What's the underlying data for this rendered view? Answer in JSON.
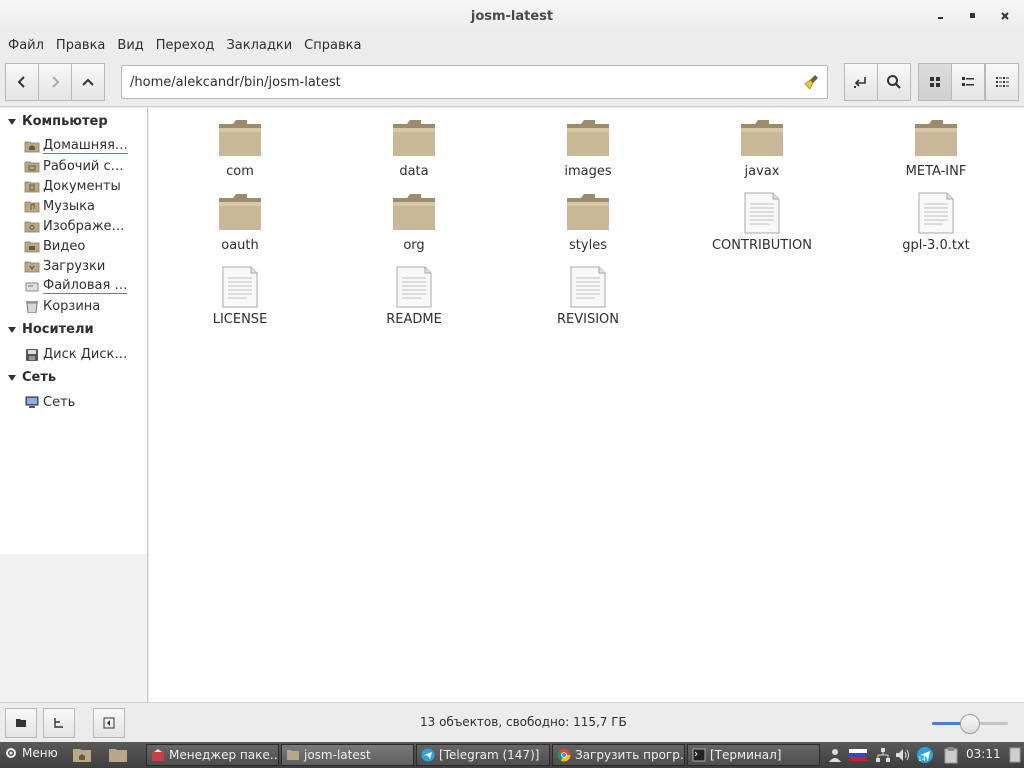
{
  "window": {
    "title": "josm-latest"
  },
  "menu": [
    "Файл",
    "Правка",
    "Вид",
    "Переход",
    "Закладки",
    "Справка"
  ],
  "toolbar": {
    "path": "/home/alekcandr/bin/josm-latest"
  },
  "sidebar": {
    "sections": [
      {
        "title": "Компьютер",
        "items": [
          "Домашняя…",
          "Рабочий с…",
          "Документы",
          "Музыка",
          "Изображе…",
          "Видео",
          "Загрузки",
          "Файловая …",
          "Корзина"
        ]
      },
      {
        "title": "Носители",
        "items": [
          "Диск Диск…"
        ]
      },
      {
        "title": "Сеть",
        "items": [
          "Сеть"
        ]
      }
    ]
  },
  "files": [
    {
      "name": "com",
      "kind": "folder"
    },
    {
      "name": "data",
      "kind": "folder"
    },
    {
      "name": "images",
      "kind": "folder"
    },
    {
      "name": "javax",
      "kind": "folder"
    },
    {
      "name": "META-INF",
      "kind": "folder"
    },
    {
      "name": "oauth",
      "kind": "folder"
    },
    {
      "name": "org",
      "kind": "folder"
    },
    {
      "name": "styles",
      "kind": "folder"
    },
    {
      "name": "CONTRIBUTION",
      "kind": "file"
    },
    {
      "name": "gpl-3.0.txt",
      "kind": "file"
    },
    {
      "name": "LICENSE",
      "kind": "file"
    },
    {
      "name": "README",
      "kind": "file"
    },
    {
      "name": "REVISION",
      "kind": "file"
    }
  ],
  "status": {
    "text": "13 объектов, свободно: 115,7 ГБ",
    "zoom_fraction": 0.5
  },
  "taskbar": {
    "menu_label": "Меню",
    "tasks": [
      "Менеджер паке…",
      "josm-latest",
      "[Telegram (147)]",
      "Загрузить прогр…",
      "[Терминал]"
    ],
    "tray_badge": "147",
    "clock": "03:11"
  },
  "colors": {
    "accent": "#4a7fd0",
    "folder": "#b8a888",
    "taskbar": "#4a4a4a"
  }
}
